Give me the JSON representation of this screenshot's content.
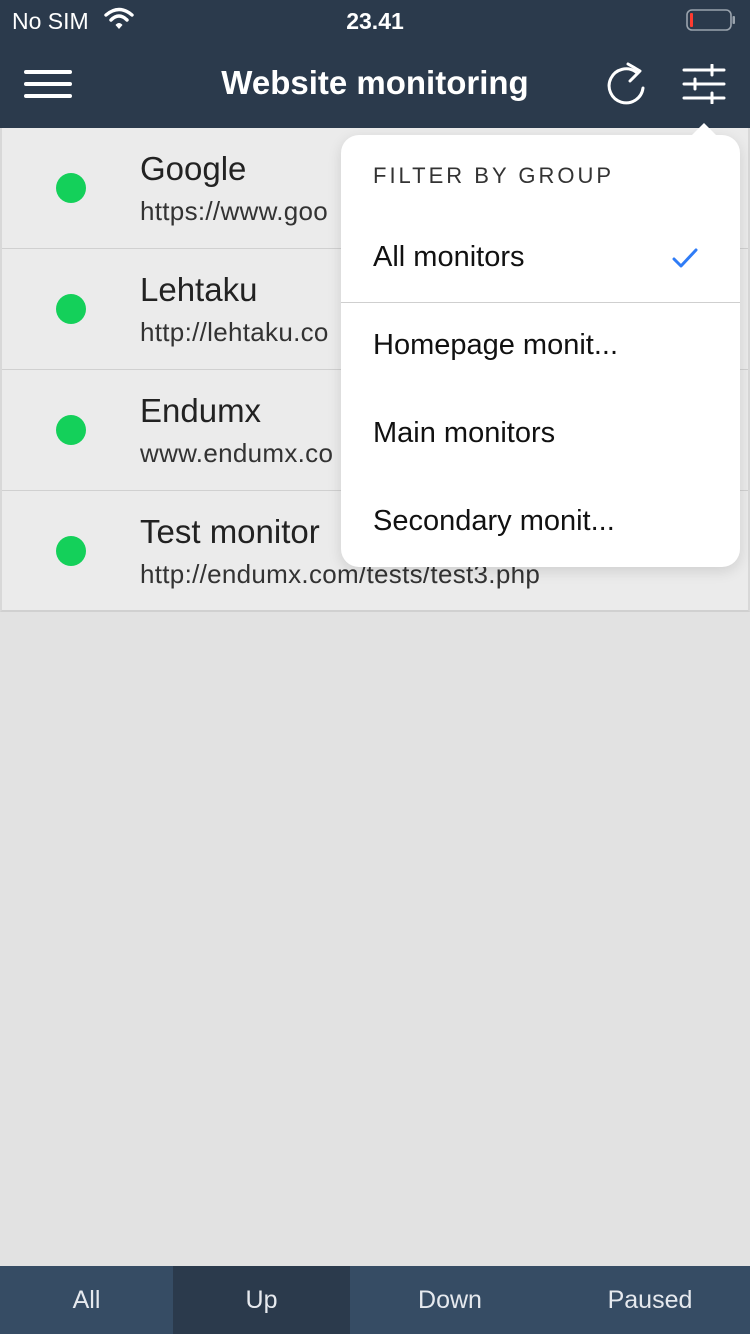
{
  "status_bar": {
    "carrier": "No SIM",
    "time": "23.41",
    "wifi_icon": "wifi-icon",
    "battery_icon": "battery-low-icon"
  },
  "nav": {
    "title": "Website monitoring",
    "menu_icon": "hamburger-menu-icon",
    "refresh_icon": "refresh-icon",
    "filter_icon": "sliders-filter-icon"
  },
  "monitors": [
    {
      "name": "Google",
      "url": "https://www.goo",
      "status": "up"
    },
    {
      "name": "Lehtaku",
      "url": "http://lehtaku.co",
      "status": "up"
    },
    {
      "name": "Endumx",
      "url": "www.endumx.co",
      "status": "up"
    },
    {
      "name": "Test monitor",
      "url": "http://endumx.com/tests/test3.php",
      "status": "up"
    }
  ],
  "filter_popover": {
    "heading": "FILTER BY GROUP",
    "options": [
      {
        "label": "All monitors",
        "selected": true
      },
      {
        "label": "Homepage monit...",
        "selected": false
      },
      {
        "label": "Main monitors",
        "selected": false
      },
      {
        "label": "Secondary monit...",
        "selected": false
      }
    ]
  },
  "tabs": [
    {
      "label": "All",
      "active": false
    },
    {
      "label": "Up",
      "active": true
    },
    {
      "label": "Down",
      "active": false
    },
    {
      "label": "Paused",
      "active": false
    }
  ],
  "colors": {
    "header_bg": "#2b3a4c",
    "tabbar_bg": "#364c64",
    "status_up": "#14d05a",
    "check_blue": "#2f7cf6"
  }
}
